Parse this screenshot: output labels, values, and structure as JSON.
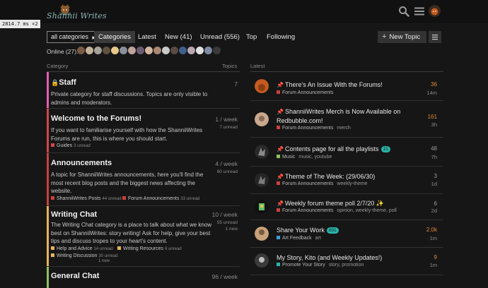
{
  "header": {
    "logo_text": "Shannii Writes",
    "debug_timer": "2814.7 ms ×2"
  },
  "nav": {
    "category_dropdown": "all categories",
    "items": [
      "Categories",
      "Latest",
      "New (41)",
      "Unread (556)",
      "Top",
      "Following"
    ],
    "new_topic": "New Topic"
  },
  "online": {
    "label": "Online (27):"
  },
  "columns": {
    "category": "Category",
    "topics": "Topics",
    "latest": "Latest"
  },
  "categories": [
    {
      "title": "Staff",
      "color": "#e45cb4",
      "desc": "Private category for staff discussions. Topics are only visible to admins and moderators.",
      "count": "7",
      "count_sub": ""
    },
    {
      "title": "Welcome to the Forums!",
      "color": "#d1464b",
      "desc": "If you want to familiarise yourself with how the ShanniiWrites Forums are run, this is where you should start.",
      "count": "1 / week",
      "count_sub": "7 unread",
      "subcats": [
        {
          "name": "Guides",
          "unread": "3 unread",
          "color": "#d1464b"
        }
      ]
    },
    {
      "title": "Announcements",
      "color": "#cc3f3f",
      "desc": "A topic for ShanniiWrites announcements, here you'll find the most recent blog posts and the biggest news affecting the website.",
      "count": "4 / week",
      "count_sub": "80 unread",
      "subcats": [
        {
          "name": "ShanniiWrites Posts",
          "unread": "44 unread",
          "color": "#cc3f3f"
        },
        {
          "name": "Forum Announcements",
          "unread": "33 unread",
          "color": "#cc3f3f"
        }
      ]
    },
    {
      "title": "Writing Chat",
      "color": "#e9b456",
      "desc": "The Writing Chat category is a place to talk about what we know best on ShanniiWrites: story writing! Ask for help, give your best tips and discuss tropes to your heart's content.",
      "count": "10 / week",
      "count_sub": "55 unread",
      "count_sub2": "1 new",
      "subcats": [
        {
          "name": "Help and Advice",
          "unread": "14 unread",
          "color": "#e9b456"
        },
        {
          "name": "Writing Resources",
          "unread": "6 unread",
          "color": "#e9b456"
        },
        {
          "name": "Writing Discussion",
          "unread": "30 unread",
          "extra": "1 new",
          "color": "#e9b456"
        }
      ]
    },
    {
      "title": "General Chat",
      "color": "#8fc25d",
      "desc": "",
      "count": "96 / week",
      "count_sub": ""
    }
  ],
  "latest": [
    {
      "pinned": true,
      "title": "There's An Issue With the Forums!",
      "category": "Forum Announcements",
      "cat_color": "#cc3f3f",
      "tags": "",
      "replies": "36",
      "reply_color": "#e0873b",
      "age": "14m",
      "avatar_color": "#c55a21"
    },
    {
      "pinned": true,
      "title": "ShanniiWrites Merch is Now Available on Redbubble.com!",
      "category": "Forum Announcements",
      "cat_color": "#cc3f3f",
      "tags": "merch",
      "replies": "161",
      "reply_color": "#e0873b",
      "age": "3h",
      "avatar_color": "#c9a98d"
    },
    {
      "pinned": true,
      "title": "Contents page for all the playlists",
      "badge": "15",
      "category": "Music",
      "cat_color": "#8fc25d",
      "tags": "music, youtube",
      "replies": "48",
      "reply_color": "#9d9d9d",
      "age": "7h",
      "avatar_color": "#3b3b3b"
    },
    {
      "pinned": true,
      "title": "Theme of The Week: (29/06/30)",
      "category": "Forum Announcements",
      "cat_color": "#cc3f3f",
      "tags": "weekly-theme",
      "replies": "3",
      "reply_color": "#9d9d9d",
      "age": "1d",
      "avatar_color": "#2e2e2e"
    },
    {
      "pinned": true,
      "title": "Weekly forum theme poll 2/7/20 ✨",
      "category": "Forum Announcements",
      "cat_color": "#cc3f3f",
      "tags": "opinion, weekly-theme, poll",
      "replies": "6",
      "reply_color": "#9d9d9d",
      "age": "2d",
      "avatar_color": "#111111"
    },
    {
      "pinned": false,
      "title": "Share Your Work",
      "badge": "891",
      "category": "Art Feedback",
      "cat_color": "#3e9ed6",
      "tags": "art",
      "replies": "2.0k",
      "reply_color": "#e0873b",
      "age": "1m",
      "avatar_color": "#c7a27b"
    },
    {
      "pinned": false,
      "title": "My Story, Kito (and Weekly Updates!)",
      "category": "Promote Your Story",
      "cat_color": "#2bb3a8",
      "tags": "story, promotion",
      "replies": "9",
      "reply_color": "#e0873b",
      "age": "1m",
      "avatar_color": "#3a3a3a"
    }
  ]
}
